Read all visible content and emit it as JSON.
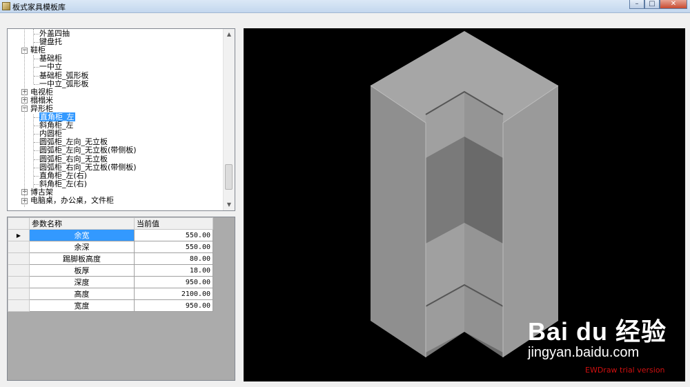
{
  "window": {
    "title": "板式家具模板库",
    "min": "–",
    "max": "□",
    "close": "✕"
  },
  "tree": {
    "rows": [
      {
        "label": "外盖四抽",
        "level": 2
      },
      {
        "label": "键盘托",
        "level": 2
      },
      {
        "label": "鞋柜",
        "level": 1,
        "expander": "−"
      },
      {
        "label": "基础柜",
        "level": 2
      },
      {
        "label": "一中立",
        "level": 2
      },
      {
        "label": "基础柜_弧形板",
        "level": 2
      },
      {
        "label": "一中立_弧形板",
        "level": 2
      },
      {
        "label": "电视柜",
        "level": 1,
        "expander": "+"
      },
      {
        "label": "榻榻米",
        "level": 1,
        "expander": "+"
      },
      {
        "label": "异形柜",
        "level": 1,
        "expander": "−"
      },
      {
        "label": "直角柜_左",
        "level": 2,
        "selected": true
      },
      {
        "label": "斜角柜_左",
        "level": 2
      },
      {
        "label": "内圆柜",
        "level": 2
      },
      {
        "label": "圆弧柜_左向_无立板",
        "level": 2
      },
      {
        "label": "圆弧柜_左向_无立板(带侧板)",
        "level": 2
      },
      {
        "label": "圆弧柜_右向_无立板",
        "level": 2
      },
      {
        "label": "圆弧柜_右向_无立板(带侧板)",
        "level": 2
      },
      {
        "label": "直角柜_左(右)",
        "level": 2
      },
      {
        "label": "斜角柜_左(右)",
        "level": 2
      },
      {
        "label": "博古架",
        "level": 1,
        "expander": "+"
      },
      {
        "label": "电脑桌，办公桌，文件柜",
        "level": 1,
        "expander": "+"
      }
    ],
    "scroll_up": "▲",
    "scroll_down": "▼"
  },
  "grid": {
    "headers": [
      "参数名称",
      "当前值"
    ],
    "current_marker": "▶",
    "rows": [
      {
        "name": "余宽",
        "value": "550.00"
      },
      {
        "name": "余深",
        "value": "550.00"
      },
      {
        "name": "踢脚板高度",
        "value": "80.00"
      },
      {
        "name": "板厚",
        "value": "18.00"
      },
      {
        "name": "深度",
        "value": "950.00"
      },
      {
        "name": "高度",
        "value": "2100.00"
      },
      {
        "name": "宽度",
        "value": "950.00"
      }
    ]
  },
  "viewport": {
    "watermark": "EWDraw trial version"
  },
  "baidu": {
    "logo": "Bai du 经验",
    "url": "jingyan.baidu.com"
  }
}
